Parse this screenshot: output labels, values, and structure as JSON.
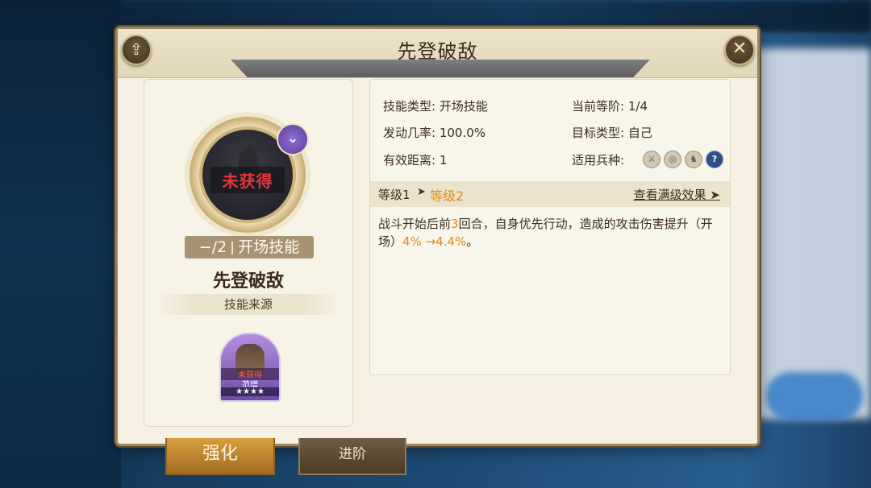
{
  "dialog": {
    "title": "先登破敌"
  },
  "skill_card": {
    "status_stamp": "未获得",
    "level_text": "−/2",
    "skill_kind": "开场技能",
    "name": "先登破敌",
    "source_label": "技能来源"
  },
  "hero": {
    "status": "未获得",
    "name": "范增",
    "stars": "★★★★"
  },
  "attributes": {
    "type_key": "技能类型:",
    "type_val": "开场技能",
    "rank_key": "当前等阶:",
    "rank_val": "1/4",
    "rate_key": "发动几率:",
    "rate_val": "100.0%",
    "target_key": "目标类型:",
    "target_val": "自己",
    "range_key": "有效距离:",
    "range_val": "1",
    "troop_key": "适用兵种:"
  },
  "troop_icons": [
    "sword-icon",
    "shield-icon",
    "horse-icon",
    "question-icon"
  ],
  "level_bar": {
    "current": "等级1",
    "arrow": "➤",
    "next": "等级2",
    "view_full": "查看满级效果"
  },
  "description": {
    "p1": "战斗开始后前",
    "rounds": "3",
    "p2": "回合，自身优先行动，造成的攻击伤害提升（开场）",
    "from": "4%",
    "arrow_to": "→4.4%",
    "end": "。"
  },
  "tabs": {
    "strengthen": "强化",
    "advance": "进阶"
  },
  "colors": {
    "accent_orange": "#e08a1e",
    "stamp_red": "#e5373b",
    "panel_bg": "#f6f1e2"
  }
}
